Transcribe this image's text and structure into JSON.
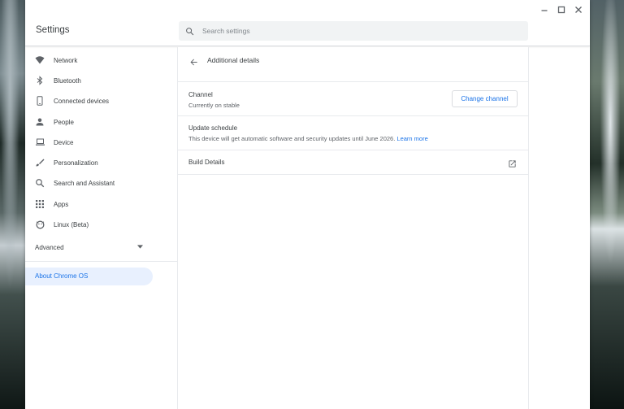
{
  "app": {
    "title": "Settings"
  },
  "search": {
    "placeholder": "Search settings"
  },
  "sidebar": {
    "items": [
      {
        "label": "Network",
        "icon": "wifi-icon"
      },
      {
        "label": "Bluetooth",
        "icon": "bluetooth-icon"
      },
      {
        "label": "Connected devices",
        "icon": "phone-icon"
      },
      {
        "label": "People",
        "icon": "person-icon"
      },
      {
        "label": "Device",
        "icon": "laptop-icon"
      },
      {
        "label": "Personalization",
        "icon": "brush-icon"
      },
      {
        "label": "Search and Assistant",
        "icon": "search-icon"
      },
      {
        "label": "Apps",
        "icon": "apps-grid-icon"
      },
      {
        "label": "Linux (Beta)",
        "icon": "linux-icon"
      }
    ],
    "advanced_label": "Advanced",
    "about_label": "About Chrome OS"
  },
  "main": {
    "title": "Additional details",
    "channel": {
      "title": "Channel",
      "subtitle": "Currently on stable",
      "button_label": "Change channel"
    },
    "update_schedule": {
      "title": "Update schedule",
      "text": "This device will get automatic software and security updates until June 2026.",
      "link": "Learn more"
    },
    "build_details": {
      "title": "Build Details"
    }
  },
  "colors": {
    "accent": "#1a73e8",
    "selected_bg": "#e8f0fe",
    "text": "#3c4043",
    "secondary_text": "#5f6368"
  }
}
